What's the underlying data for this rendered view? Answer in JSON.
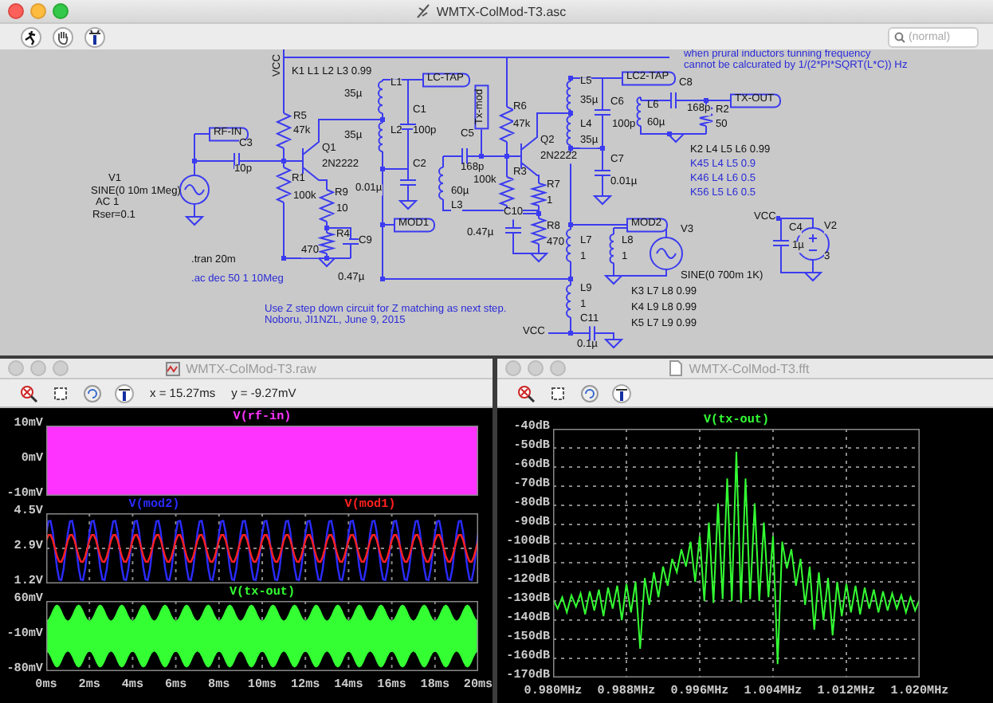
{
  "schematic_window": {
    "title": "WMTX-ColMod-T3.asc",
    "search": {
      "placeholder": "(normal)"
    },
    "labels": [
      {
        "text": "VCC",
        "kind": "vtext"
      },
      {
        "text": "K1 L1 L2 L3 0.99",
        "kind": "text"
      },
      {
        "text": "LC-TAP",
        "kind": "flag"
      },
      {
        "text": "L1",
        "kind": "text"
      },
      {
        "text": "35µ",
        "kind": "text"
      },
      {
        "text": "C1",
        "kind": "text"
      },
      {
        "text": "R5",
        "kind": "text"
      },
      {
        "text": "RF-IN",
        "kind": "flag"
      },
      {
        "text": "47k",
        "kind": "text"
      },
      {
        "text": "35µ",
        "kind": "text"
      },
      {
        "text": "L2",
        "kind": "text"
      },
      {
        "text": "100p",
        "kind": "text"
      },
      {
        "text": "Q1",
        "kind": "text"
      },
      {
        "text": "C3",
        "kind": "text"
      },
      {
        "text": "10p",
        "kind": "text"
      },
      {
        "text": "2N2222",
        "kind": "text"
      },
      {
        "text": "C2",
        "kind": "text"
      },
      {
        "text": "V1",
        "kind": "text"
      },
      {
        "text": "SINE(0 10m 1Meg)",
        "kind": "text"
      },
      {
        "text": "R1",
        "kind": "text"
      },
      {
        "text": "0.01µ",
        "kind": "text"
      },
      {
        "text": "100k",
        "kind": "text"
      },
      {
        "text": "R9",
        "kind": "text"
      },
      {
        "text": "AC 1",
        "kind": "text"
      },
      {
        "text": "60µ",
        "kind": "text"
      },
      {
        "text": "L3",
        "kind": "text"
      },
      {
        "text": "C5",
        "kind": "text"
      },
      {
        "text": "168p",
        "kind": "text"
      },
      {
        "text": "100k",
        "kind": "text"
      },
      {
        "text": "Tx-mod",
        "kind": "vflag"
      },
      {
        "text": "Rser=0.1",
        "kind": "text"
      },
      {
        "text": "10",
        "kind": "text"
      },
      {
        "text": "MOD1",
        "kind": "flag"
      },
      {
        "text": "R4",
        "kind": "text"
      },
      {
        "text": "C9",
        "kind": "text"
      },
      {
        "text": "0.47µ",
        "kind": "text"
      },
      {
        "text": ".tran 20m",
        "kind": "text"
      },
      {
        "text": "470",
        "kind": "text"
      },
      {
        "text": ".ac dec 50 1 10Meg",
        "kind": "comment"
      },
      {
        "text": "0.47µ",
        "kind": "text"
      },
      {
        "text": "Use Z step down circuit for Z matching as next step.",
        "kind": "comment"
      },
      {
        "text": "Noboru, JI1NZL, June 9, 2015",
        "kind": "comment"
      },
      {
        "text": "when prural inductors tunning frequency",
        "kind": "comment"
      },
      {
        "text": "cannot be calcurated by 1/(2*PI*SQRT(L*C)) Hz",
        "kind": "comment"
      },
      {
        "text": "LC2-TAP",
        "kind": "flag"
      },
      {
        "text": "L5",
        "kind": "text"
      },
      {
        "text": "C8",
        "kind": "text"
      },
      {
        "text": "TX-OUT",
        "kind": "flag"
      },
      {
        "text": "R6",
        "kind": "text"
      },
      {
        "text": "35µ",
        "kind": "text"
      },
      {
        "text": "C6",
        "kind": "text"
      },
      {
        "text": "L6",
        "kind": "text"
      },
      {
        "text": "168p",
        "kind": "text"
      },
      {
        "text": "R2",
        "kind": "text"
      },
      {
        "text": "47k",
        "kind": "text"
      },
      {
        "text": "L4",
        "kind": "text"
      },
      {
        "text": "100p",
        "kind": "text"
      },
      {
        "text": "60µ",
        "kind": "text"
      },
      {
        "text": "50",
        "kind": "text"
      },
      {
        "text": "Q2",
        "kind": "text"
      },
      {
        "text": "35µ",
        "kind": "text"
      },
      {
        "text": "K2 L4 L5 L6 0.99",
        "kind": "text"
      },
      {
        "text": "2N2222",
        "kind": "text"
      },
      {
        "text": "C7",
        "kind": "text"
      },
      {
        "text": "K45 L4 L5  0.9",
        "kind": "comment"
      },
      {
        "text": "R3",
        "kind": "text"
      },
      {
        "text": "K46 L4 L6  0.5",
        "kind": "comment"
      },
      {
        "text": "R7",
        "kind": "text"
      },
      {
        "text": "0.01µ",
        "kind": "text"
      },
      {
        "text": "K56 L5 L6  0.5",
        "kind": "comment"
      },
      {
        "text": "1",
        "kind": "text"
      },
      {
        "text": "C10",
        "kind": "text"
      },
      {
        "text": "R8",
        "kind": "text"
      },
      {
        "text": "MOD2",
        "kind": "flag"
      },
      {
        "text": "V3",
        "kind": "text"
      },
      {
        "text": "VCC",
        "kind": "text"
      },
      {
        "text": "C4",
        "kind": "text"
      },
      {
        "text": "V2",
        "kind": "text"
      },
      {
        "text": "L7",
        "kind": "text"
      },
      {
        "text": "L8",
        "kind": "text"
      },
      {
        "text": "1µ",
        "kind": "text"
      },
      {
        "text": "470",
        "kind": "text"
      },
      {
        "text": "1",
        "kind": "text"
      },
      {
        "text": "1",
        "kind": "text"
      },
      {
        "text": "3",
        "kind": "text"
      },
      {
        "text": "SINE(0 700m 1K)",
        "kind": "text"
      },
      {
        "text": "L9",
        "kind": "text"
      },
      {
        "text": "K3 L7 L8 0.99",
        "kind": "text"
      },
      {
        "text": "1",
        "kind": "text"
      },
      {
        "text": "K4 L9 L8 0.99",
        "kind": "text"
      },
      {
        "text": "C11",
        "kind": "text"
      },
      {
        "text": "VCC",
        "kind": "text"
      },
      {
        "text": "K5 L7 L9 0.99",
        "kind": "text"
      },
      {
        "text": "0.1µ",
        "kind": "text"
      }
    ]
  },
  "waveform_window": {
    "title": "WMTX-ColMod-T3.raw",
    "cursor_x": "x = 15.27ms",
    "cursor_y": "y = -9.27mV",
    "panes": [
      {
        "kind": "carrier",
        "traces": [
          {
            "name": "V(rf-in)",
            "color": "#ff33ff"
          }
        ],
        "yticks": [
          "10mV",
          "0mV",
          "-10mV"
        ]
      },
      {
        "kind": "tones",
        "traces": [
          {
            "name": "V(mod2)",
            "color": "#2b2bff"
          },
          {
            "name": "V(mod1)",
            "color": "#ff2020"
          }
        ],
        "yticks": [
          "4.5V",
          "2.9V",
          "1.2V"
        ]
      },
      {
        "kind": "am",
        "traces": [
          {
            "name": "V(tx-out)",
            "color": "#33ff33"
          }
        ],
        "yticks": [
          "60mV",
          "-10mV",
          "-80mV"
        ]
      }
    ],
    "xticks": [
      "0ms",
      "2ms",
      "4ms",
      "6ms",
      "8ms",
      "10ms",
      "12ms",
      "14ms",
      "16ms",
      "18ms",
      "20ms"
    ]
  },
  "fft_window": {
    "title": "WMTX-ColMod-T3.fft",
    "chart_data": {
      "type": "line",
      "x": [
        0.98,
        0.9805,
        0.981,
        0.9815,
        0.982,
        0.9825,
        0.983,
        0.9835,
        0.984,
        0.9845,
        0.985,
        0.9855,
        0.986,
        0.9865,
        0.987,
        0.9875,
        0.988,
        0.9885,
        0.989,
        0.9895,
        0.99,
        0.9905,
        0.991,
        0.9915,
        0.992,
        0.9925,
        0.993,
        0.9935,
        0.994,
        0.9945,
        0.995,
        0.9955,
        0.996,
        0.9965,
        0.997,
        0.9975,
        0.998,
        0.9985,
        0.999,
        0.9995,
        1.0,
        1.0005,
        1.001,
        1.0015,
        1.002,
        1.0025,
        1.003,
        1.0035,
        1.004,
        1.0045,
        1.005,
        1.0055,
        1.006,
        1.0065,
        1.007,
        1.0075,
        1.008,
        1.0085,
        1.009,
        1.0095,
        1.01,
        1.0105,
        1.011,
        1.0115,
        1.012,
        1.0125,
        1.013,
        1.0135,
        1.014,
        1.0145,
        1.015,
        1.0155,
        1.016,
        1.0165,
        1.017,
        1.0175,
        1.018,
        1.0185,
        1.019,
        1.0195,
        1.02
      ],
      "series": [
        {
          "name": "V(tx-out)",
          "color": "#33ff33",
          "values": [
            -129,
            -134,
            -128,
            -136,
            -127,
            -133,
            -126,
            -137,
            -125,
            -135,
            -124,
            -138,
            -123,
            -134,
            -122,
            -140,
            -121,
            -136,
            -120,
            -155,
            -118,
            -132,
            -115,
            -128,
            -112,
            -122,
            -108,
            -115,
            -103,
            -112,
            -99,
            -120,
            -96,
            -130,
            -89,
            -131,
            -79,
            -129,
            -66,
            -130,
            -52,
            -131,
            -66,
            -129,
            -79,
            -130,
            -89,
            -128,
            -96,
            -163,
            -99,
            -113,
            -103,
            -122,
            -108,
            -132,
            -112,
            -145,
            -115,
            -140,
            -118,
            -148,
            -120,
            -138,
            -121,
            -136,
            -122,
            -137,
            -123,
            -134,
            -124,
            -136,
            -125,
            -135,
            -126,
            -134,
            -127,
            -136,
            -128,
            -135,
            -129
          ]
        }
      ],
      "xlim": [
        0.98,
        1.02
      ],
      "ylim": [
        -170,
        -40
      ],
      "grid": true,
      "xticks": [
        {
          "value": 0.98,
          "label": "0.980MHz"
        },
        {
          "value": 0.988,
          "label": "0.988MHz"
        },
        {
          "value": 0.996,
          "label": "0.996MHz"
        },
        {
          "value": 1.004,
          "label": "1.004MHz"
        },
        {
          "value": 1.012,
          "label": "1.012MHz"
        },
        {
          "value": 1.02,
          "label": "1.020MHz"
        }
      ],
      "yticks": [
        {
          "value": -40,
          "label": "-40dB"
        },
        {
          "value": -50,
          "label": "-50dB"
        },
        {
          "value": -60,
          "label": "-60dB"
        },
        {
          "value": -70,
          "label": "-70dB"
        },
        {
          "value": -80,
          "label": "-80dB"
        },
        {
          "value": -90,
          "label": "-90dB"
        },
        {
          "value": -100,
          "label": "-100dB"
        },
        {
          "value": -110,
          "label": "-110dB"
        },
        {
          "value": -120,
          "label": "-120dB"
        },
        {
          "value": -130,
          "label": "-130dB"
        },
        {
          "value": -140,
          "label": "-140dB"
        },
        {
          "value": -150,
          "label": "-150dB"
        },
        {
          "value": -160,
          "label": "-160dB"
        },
        {
          "value": -170,
          "label": "-170dB"
        }
      ]
    }
  }
}
